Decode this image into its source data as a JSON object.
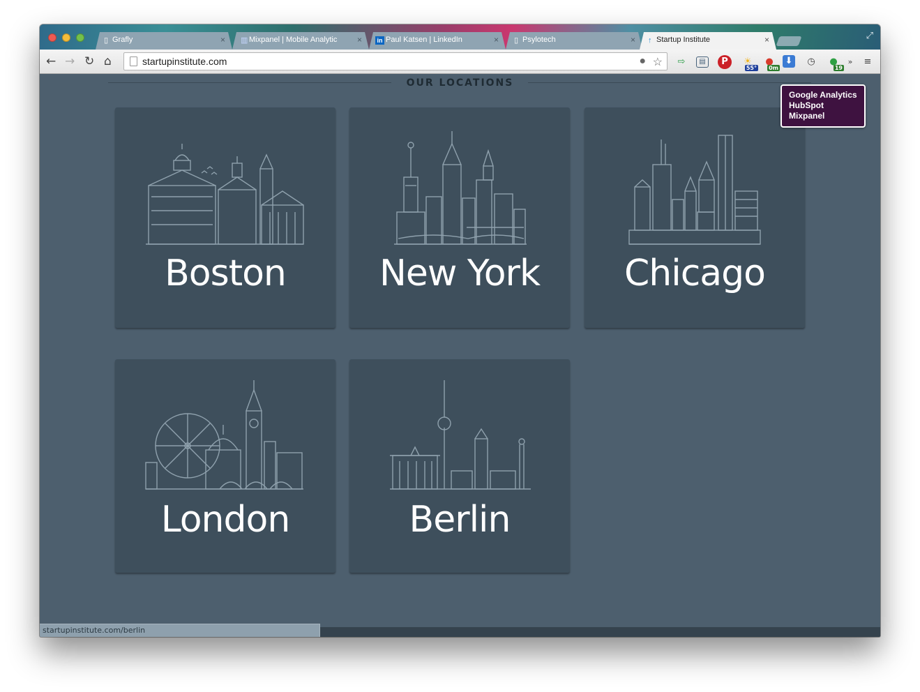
{
  "browser": {
    "tabs": [
      {
        "title": "Grafly",
        "icon": "page-icon",
        "active": false
      },
      {
        "title": "Mixpanel | Mobile Analytic",
        "icon": "mixpanel-icon",
        "active": false
      },
      {
        "title": "Paul Katsen | LinkedIn",
        "icon": "linkedin-icon",
        "active": false
      },
      {
        "title": "Psylotech",
        "icon": "page-icon",
        "active": false
      },
      {
        "title": "Startup Institute",
        "icon": "startup-institute-icon",
        "active": true
      }
    ],
    "close_glyph": "×",
    "address": "startupinstitute.com",
    "extensions": [
      {
        "name": "lightbulb-icon"
      },
      {
        "name": "bookmark-star-icon"
      },
      {
        "name": "send-to-icon"
      },
      {
        "name": "window-icon"
      },
      {
        "name": "pinterest-icon"
      },
      {
        "name": "weather-icon",
        "badge": "55°"
      },
      {
        "name": "traffic-icon",
        "badge": "0m"
      },
      {
        "name": "download-icon"
      },
      {
        "name": "clock-icon"
      },
      {
        "name": "evernote-icon",
        "badge": "19"
      },
      {
        "name": "overflow-icon"
      },
      {
        "name": "menu-icon"
      }
    ],
    "status_url": "startupinstitute.com/berlin"
  },
  "page": {
    "section_title": "OUR LOCATIONS",
    "locations": [
      {
        "name": "Boston",
        "skyline": "boston-skyline"
      },
      {
        "name": "New York",
        "skyline": "new-york-skyline"
      },
      {
        "name": "Chicago",
        "skyline": "chicago-skyline"
      },
      {
        "name": "London",
        "skyline": "london-skyline"
      },
      {
        "name": "Berlin",
        "skyline": "berlin-skyline"
      }
    ]
  },
  "tooltip": {
    "lines": [
      "Google Analytics",
      "HubSpot",
      "Mixpanel"
    ]
  },
  "colors": {
    "page_bg": "#4d5f6e",
    "card_bg": "#3e4f5c",
    "line_art": "#8fa1ad",
    "tooltip_bg": "#3e1240"
  }
}
